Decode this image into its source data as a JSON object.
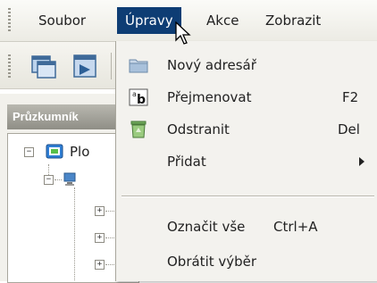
{
  "menubar": {
    "items": [
      {
        "label": "Soubor"
      },
      {
        "label": "Úpravy"
      },
      {
        "label": "Akce"
      },
      {
        "label": "Zobrazit"
      }
    ]
  },
  "explorer": {
    "panel_title": "Průzkumník",
    "tree_root_label": "Plo",
    "expander_collapsed": "+",
    "expander_expanded": "−"
  },
  "dropdown": {
    "items": [
      {
        "label": "Nový adresář",
        "shortcut": "",
        "icon": "folder-icon"
      },
      {
        "label": "Přejmenovat",
        "shortcut": "F2",
        "icon": "rename-icon"
      },
      {
        "label": "Odstranit",
        "shortcut": "Del",
        "icon": "recycle-bin-icon"
      },
      {
        "label": "Přidat",
        "shortcut": "",
        "icon": "",
        "submenu": true
      },
      {
        "label": "Označit vše",
        "shortcut": "Ctrl+A",
        "icon": ""
      },
      {
        "label": "Obrátit výběr",
        "shortcut": "",
        "icon": ""
      }
    ]
  },
  "colors": {
    "menu_active_bg": "#0e3d74",
    "menu_bg": "#f3f2ee",
    "panel_header": "#9f9e96"
  }
}
